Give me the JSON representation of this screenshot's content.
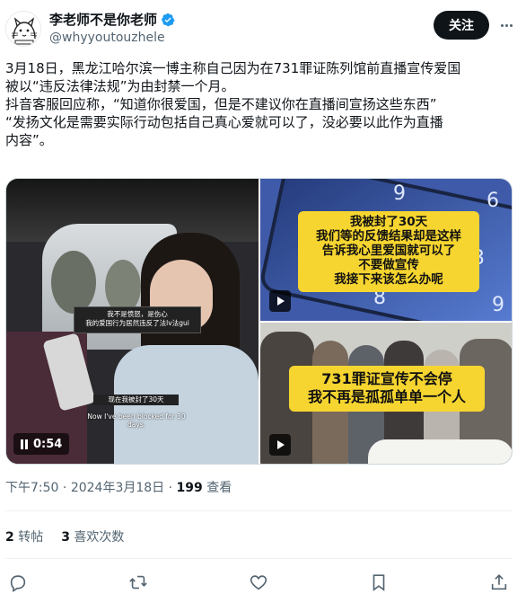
{
  "author": {
    "display_name": "李老师不是你老师",
    "handle": "@whyyoutouzhele",
    "verified": true,
    "avatar_icon": "sketch-cat-avatar"
  },
  "header": {
    "follow_label": "关注",
    "more_icon": "more-horizontal-icon"
  },
  "tweet": {
    "lines": [
      "3月18日，黑龙江哈尔滨一博主称自己因为在731罪证陈列馆前直播宣传爱国",
      "被以“违反法律法规”为由封禁一个月。",
      "抖音客服回应称，“知道你很爱国，但是不建议你在直播间宣扬这些东西”",
      "“发扬文化是需要实际行动包括自己真心爱就可以了，没必要以此作为直播",
      "内容”。"
    ]
  },
  "media": {
    "left_video": {
      "caption_1_line1": "我不是愤怒，是伤心",
      "caption_1_line2": "我的爱国行为居然违反了法lv法gui",
      "caption_2": "现在我被封了30天",
      "caption_english": "Now I've been blocked for 30 days.",
      "duration": "0:54"
    },
    "top_right_video": {
      "lines": [
        "我被封了30天",
        "我们等的反馈结果却是这样",
        "告诉我心里爱国就可以了",
        "不要做宣传",
        "我接下来该怎么办呢"
      ],
      "keypad": [
        "9",
        "6",
        "3",
        "8",
        "9"
      ]
    },
    "bottom_right_video": {
      "lines": [
        "731罪证宣传不会停",
        "我不再是孤孤单单一个人"
      ]
    }
  },
  "meta": {
    "time": "下午7:50",
    "separator": "·",
    "date": "2024年3月18日",
    "views_count": "199",
    "views_label": "查看"
  },
  "stats": {
    "retweets_count": "2",
    "retweets_label": "转帖",
    "quotes_count": "3",
    "quotes_label": "喜欢次数"
  },
  "actions": [
    "reply-icon",
    "retweet-icon",
    "like-icon",
    "bookmark-icon",
    "share-icon"
  ],
  "colors": {
    "text_primary": "#0f1419",
    "text_secondary": "#536471",
    "verified_blue": "#1d9bf0",
    "caption_yellow": "#f6d530",
    "divider": "#eff3f4"
  }
}
